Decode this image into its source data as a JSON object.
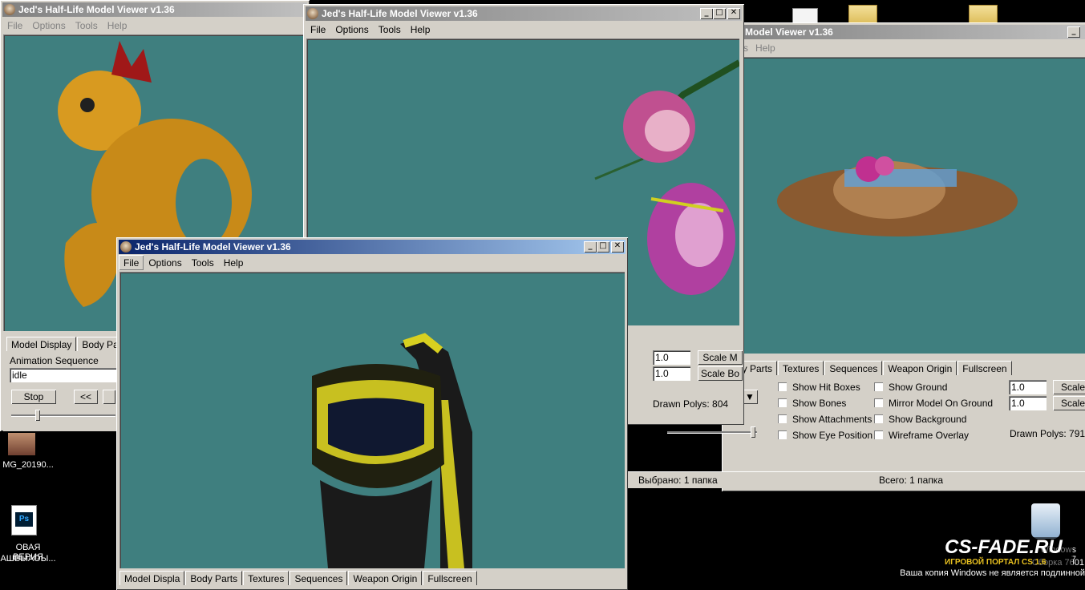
{
  "window1": {
    "title": "Jed's Half-Life Model Viewer v1.36",
    "menu": [
      "File",
      "Options",
      "Tools",
      "Help"
    ],
    "tabs": [
      "Model Display",
      "Body Parts"
    ],
    "anim_label": "Animation Sequence",
    "anim_value": "idle",
    "stop_label": "Stop",
    "rew_label": "<<"
  },
  "window2": {
    "title": "Jed's Half-Life Model Viewer v1.36",
    "menu": [
      "File",
      "Options",
      "Tools",
      "Help"
    ],
    "scale_value_1": "1.0",
    "scale_value_2": "1.0",
    "scale_btn_1": "Scale M",
    "scale_btn_2": "Scale Bo",
    "drawn_polys": "Drawn Polys: 804"
  },
  "window3": {
    "title": "Model Viewer v1.36",
    "menu_help": "Help",
    "menu_frag": "s",
    "tabs": [
      "dy Parts",
      "Textures",
      "Sequences",
      "Weapon Origin",
      "Fullscreen"
    ],
    "checks_left": [
      "Show Hit Boxes",
      "Show Bones",
      "Show Attachments",
      "Show Eye Position"
    ],
    "checks_right": [
      "Show Ground",
      "Mirror Model On Ground",
      "Show Background",
      "Wireframe Overlay"
    ],
    "scale_value_1": "1.0",
    "scale_value_2": "1.0",
    "scale_btn_1": "Scale",
    "scale_btn_2": "Scale",
    "drawn_polys": "Drawn Polys: 791"
  },
  "window4": {
    "title": "Jed's Half-Life Model Viewer v1.36",
    "menu": [
      "File",
      "Options",
      "Tools",
      "Help"
    ],
    "tabs_frag": [
      "Model Displa",
      "Body Parts",
      "Textures",
      "Sequences",
      "Weapon Origin",
      "Fullscreen"
    ]
  },
  "explorer_status": {
    "selected": "Выбрано: 1 папка",
    "total": "Всего: 1 папка"
  },
  "desktop": {
    "icon_img_label": "MG_20190...",
    "icon_psd_label_1": "ОВАЯ ВЕРИЯ",
    "icon_psd_label_2": "АШВЫАОЫ...",
    "recycle_text": "Windows 7",
    "build_text": "Сборка 7601",
    "activation_text": "Ваша копия Windows не является подлинной",
    "watermark_big": "CS-FADE.RU",
    "watermark_small": "ИГРОВОЙ ПОРТАЛ CS 1.6"
  },
  "colors": {
    "viewport": "#3f7f7f",
    "active_title": "#0a246a",
    "inactive_title": "#808080"
  },
  "icons": [
    "half-life-app-icon",
    "minimize-icon",
    "maximize-icon",
    "close-icon",
    "folder-icon",
    "document-icon",
    "photoshop-icon",
    "recycle-bin-icon"
  ]
}
